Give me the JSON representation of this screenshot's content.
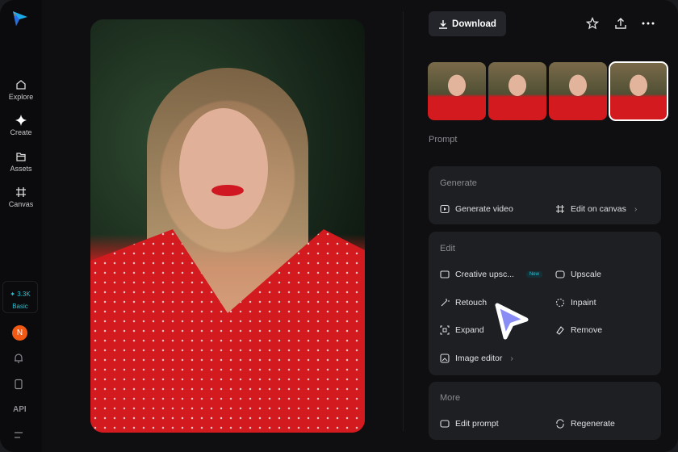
{
  "sidebar": {
    "items": [
      {
        "label": "Explore",
        "icon": "home-icon"
      },
      {
        "label": "Create",
        "icon": "sparkle-icon"
      },
      {
        "label": "Assets",
        "icon": "folder-icon"
      },
      {
        "label": "Canvas",
        "icon": "canvas-icon"
      }
    ],
    "credits": "✦ 3.3K",
    "plan": "Basic",
    "avatar_initial": "N",
    "api_label": "API"
  },
  "toolbar": {
    "download_label": "Download"
  },
  "prompt_label": "Prompt",
  "generate": {
    "title": "Generate",
    "items": [
      "Generate video",
      "Edit on canvas"
    ]
  },
  "edit": {
    "title": "Edit",
    "items": [
      "Creative upsc...",
      "Upscale",
      "Retouch",
      "Inpaint",
      "Expand",
      "Remove",
      "Image editor"
    ],
    "new_badge": "New"
  },
  "more": {
    "title": "More",
    "items": [
      "Edit prompt",
      "Regenerate"
    ]
  },
  "colors": {
    "accent": "#27c4d6",
    "avatar": "#f05a14",
    "cursor": "#8a8cf5"
  }
}
